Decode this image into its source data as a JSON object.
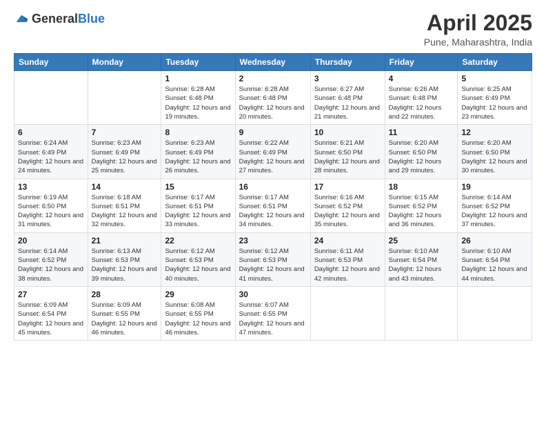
{
  "logo": {
    "general": "General",
    "blue": "Blue"
  },
  "title": "April 2025",
  "location": "Pune, Maharashtra, India",
  "days_of_week": [
    "Sunday",
    "Monday",
    "Tuesday",
    "Wednesday",
    "Thursday",
    "Friday",
    "Saturday"
  ],
  "weeks": [
    [
      null,
      null,
      {
        "day": 1,
        "sunrise": "6:28 AM",
        "sunset": "6:48 PM",
        "daylight": "12 hours and 19 minutes."
      },
      {
        "day": 2,
        "sunrise": "6:28 AM",
        "sunset": "6:48 PM",
        "daylight": "12 hours and 20 minutes."
      },
      {
        "day": 3,
        "sunrise": "6:27 AM",
        "sunset": "6:48 PM",
        "daylight": "12 hours and 21 minutes."
      },
      {
        "day": 4,
        "sunrise": "6:26 AM",
        "sunset": "6:48 PM",
        "daylight": "12 hours and 22 minutes."
      },
      {
        "day": 5,
        "sunrise": "6:25 AM",
        "sunset": "6:49 PM",
        "daylight": "12 hours and 23 minutes."
      }
    ],
    [
      {
        "day": 6,
        "sunrise": "6:24 AM",
        "sunset": "6:49 PM",
        "daylight": "12 hours and 24 minutes."
      },
      {
        "day": 7,
        "sunrise": "6:23 AM",
        "sunset": "6:49 PM",
        "daylight": "12 hours and 25 minutes."
      },
      {
        "day": 8,
        "sunrise": "6:23 AM",
        "sunset": "6:49 PM",
        "daylight": "12 hours and 26 minutes."
      },
      {
        "day": 9,
        "sunrise": "6:22 AM",
        "sunset": "6:49 PM",
        "daylight": "12 hours and 27 minutes."
      },
      {
        "day": 10,
        "sunrise": "6:21 AM",
        "sunset": "6:50 PM",
        "daylight": "12 hours and 28 minutes."
      },
      {
        "day": 11,
        "sunrise": "6:20 AM",
        "sunset": "6:50 PM",
        "daylight": "12 hours and 29 minutes."
      },
      {
        "day": 12,
        "sunrise": "6:20 AM",
        "sunset": "6:50 PM",
        "daylight": "12 hours and 30 minutes."
      }
    ],
    [
      {
        "day": 13,
        "sunrise": "6:19 AM",
        "sunset": "6:50 PM",
        "daylight": "12 hours and 31 minutes."
      },
      {
        "day": 14,
        "sunrise": "6:18 AM",
        "sunset": "6:51 PM",
        "daylight": "12 hours and 32 minutes."
      },
      {
        "day": 15,
        "sunrise": "6:17 AM",
        "sunset": "6:51 PM",
        "daylight": "12 hours and 33 minutes."
      },
      {
        "day": 16,
        "sunrise": "6:17 AM",
        "sunset": "6:51 PM",
        "daylight": "12 hours and 34 minutes."
      },
      {
        "day": 17,
        "sunrise": "6:16 AM",
        "sunset": "6:52 PM",
        "daylight": "12 hours and 35 minutes."
      },
      {
        "day": 18,
        "sunrise": "6:15 AM",
        "sunset": "6:52 PM",
        "daylight": "12 hours and 36 minutes."
      },
      {
        "day": 19,
        "sunrise": "6:14 AM",
        "sunset": "6:52 PM",
        "daylight": "12 hours and 37 minutes."
      }
    ],
    [
      {
        "day": 20,
        "sunrise": "6:14 AM",
        "sunset": "6:52 PM",
        "daylight": "12 hours and 38 minutes."
      },
      {
        "day": 21,
        "sunrise": "6:13 AM",
        "sunset": "6:53 PM",
        "daylight": "12 hours and 39 minutes."
      },
      {
        "day": 22,
        "sunrise": "6:12 AM",
        "sunset": "6:53 PM",
        "daylight": "12 hours and 40 minutes."
      },
      {
        "day": 23,
        "sunrise": "6:12 AM",
        "sunset": "6:53 PM",
        "daylight": "12 hours and 41 minutes."
      },
      {
        "day": 24,
        "sunrise": "6:11 AM",
        "sunset": "6:53 PM",
        "daylight": "12 hours and 42 minutes."
      },
      {
        "day": 25,
        "sunrise": "6:10 AM",
        "sunset": "6:54 PM",
        "daylight": "12 hours and 43 minutes."
      },
      {
        "day": 26,
        "sunrise": "6:10 AM",
        "sunset": "6:54 PM",
        "daylight": "12 hours and 44 minutes."
      }
    ],
    [
      {
        "day": 27,
        "sunrise": "6:09 AM",
        "sunset": "6:54 PM",
        "daylight": "12 hours and 45 minutes."
      },
      {
        "day": 28,
        "sunrise": "6:09 AM",
        "sunset": "6:55 PM",
        "daylight": "12 hours and 46 minutes."
      },
      {
        "day": 29,
        "sunrise": "6:08 AM",
        "sunset": "6:55 PM",
        "daylight": "12 hours and 46 minutes."
      },
      {
        "day": 30,
        "sunrise": "6:07 AM",
        "sunset": "6:55 PM",
        "daylight": "12 hours and 47 minutes."
      },
      null,
      null,
      null
    ]
  ],
  "labels": {
    "sunrise": "Sunrise:",
    "sunset": "Sunset:",
    "daylight": "Daylight:"
  }
}
